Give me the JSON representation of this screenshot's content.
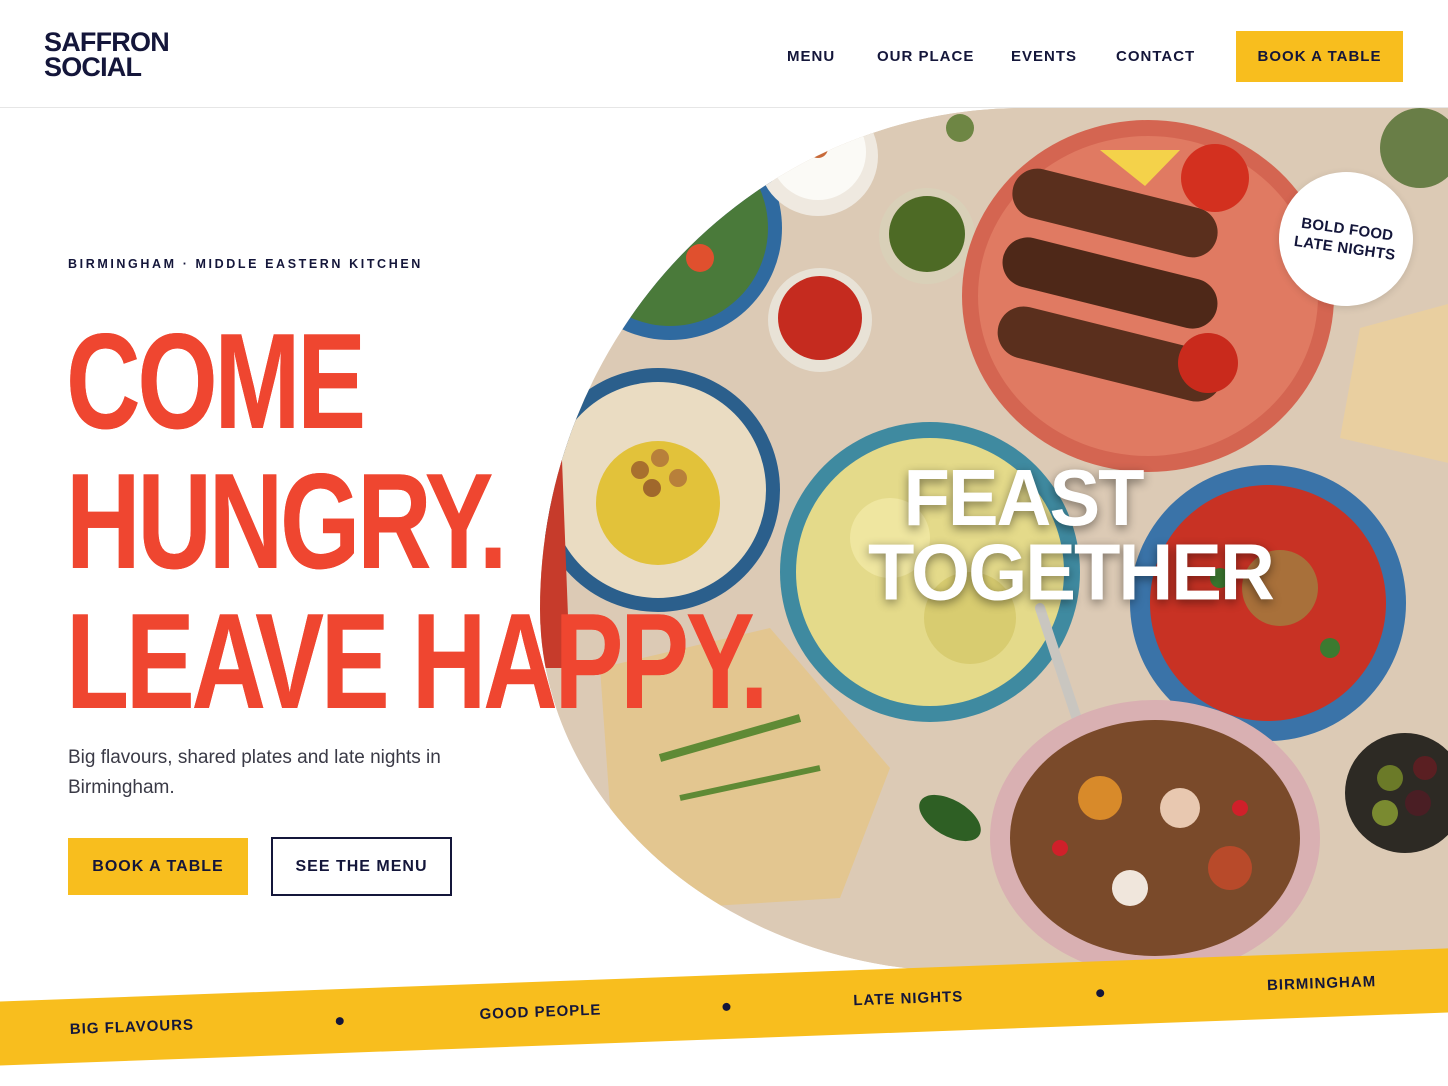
{
  "header": {
    "logo": {
      "line1": "SAFFRON",
      "line2": "SOCIAL"
    },
    "nav": [
      "MENU",
      "OUR PLACE",
      "EVENTS",
      "CONTACT"
    ],
    "cta_label": "BOOK A TABLE"
  },
  "hero": {
    "eyebrow": "BIRMINGHAM · MIDDLE EASTERN KITCHEN",
    "headline": [
      "COME",
      "HUNGRY.",
      "LEAVE HAPPY."
    ],
    "subcopy": "Big flavours, shared plates and late nights in Birmingham.",
    "primary_cta": "BOOK A TABLE",
    "secondary_cta": "SEE THE MENU",
    "image_overlay": {
      "line1": "FEAST",
      "line2": "TOGETHER"
    },
    "badge": {
      "line1": "BOLD FOOD",
      "line2": "LATE NIGHTS"
    }
  },
  "ribbon": {
    "items": [
      "BIG FLAVOURS",
      "GOOD PEOPLE",
      "LATE NIGHTS",
      "BIRMINGHAM"
    ]
  },
  "colors": {
    "accent_red": "#ef4630",
    "accent_yellow": "#f8be1e",
    "navy": "#14163a"
  },
  "icons": [
    "dot-separator"
  ]
}
